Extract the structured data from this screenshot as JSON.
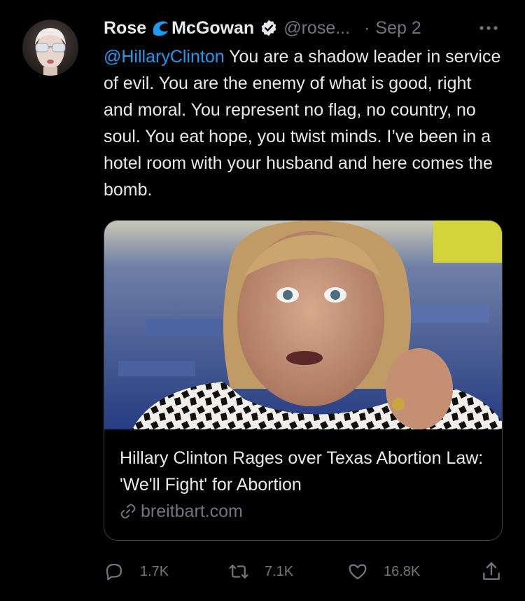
{
  "tweet": {
    "author": {
      "first_name": "Rose",
      "last_name": "McGowan",
      "handle": "@rose...",
      "separator": "·",
      "date": "Sep 2"
    },
    "text_mention": "@HillaryClinton",
    "text_body": " You are a shadow leader in service of evil. You are the enemy of what is good, right and moral. You represent no flag, no country, no soul. You eat hope, you twist minds. I’ve been in a hotel room with your husband and here comes the bomb.",
    "card": {
      "title": "Hillary Clinton Rages over Texas Abortion Law: 'We'll Fight' for Abortion",
      "domain": "breitbart.com"
    },
    "actions": {
      "replies": "1.7K",
      "retweets": "7.1K",
      "likes": "16.8K"
    }
  },
  "colors": {
    "background": "#000000",
    "text": "#e7e9ea",
    "muted": "#71767b",
    "accent": "#1d9bf0",
    "card_border": "#3b4043"
  },
  "icons": [
    "avatar",
    "wave-icon",
    "verified-icon",
    "more-icon",
    "link-icon",
    "reply-icon",
    "retweet-icon",
    "like-icon",
    "share-icon"
  ]
}
